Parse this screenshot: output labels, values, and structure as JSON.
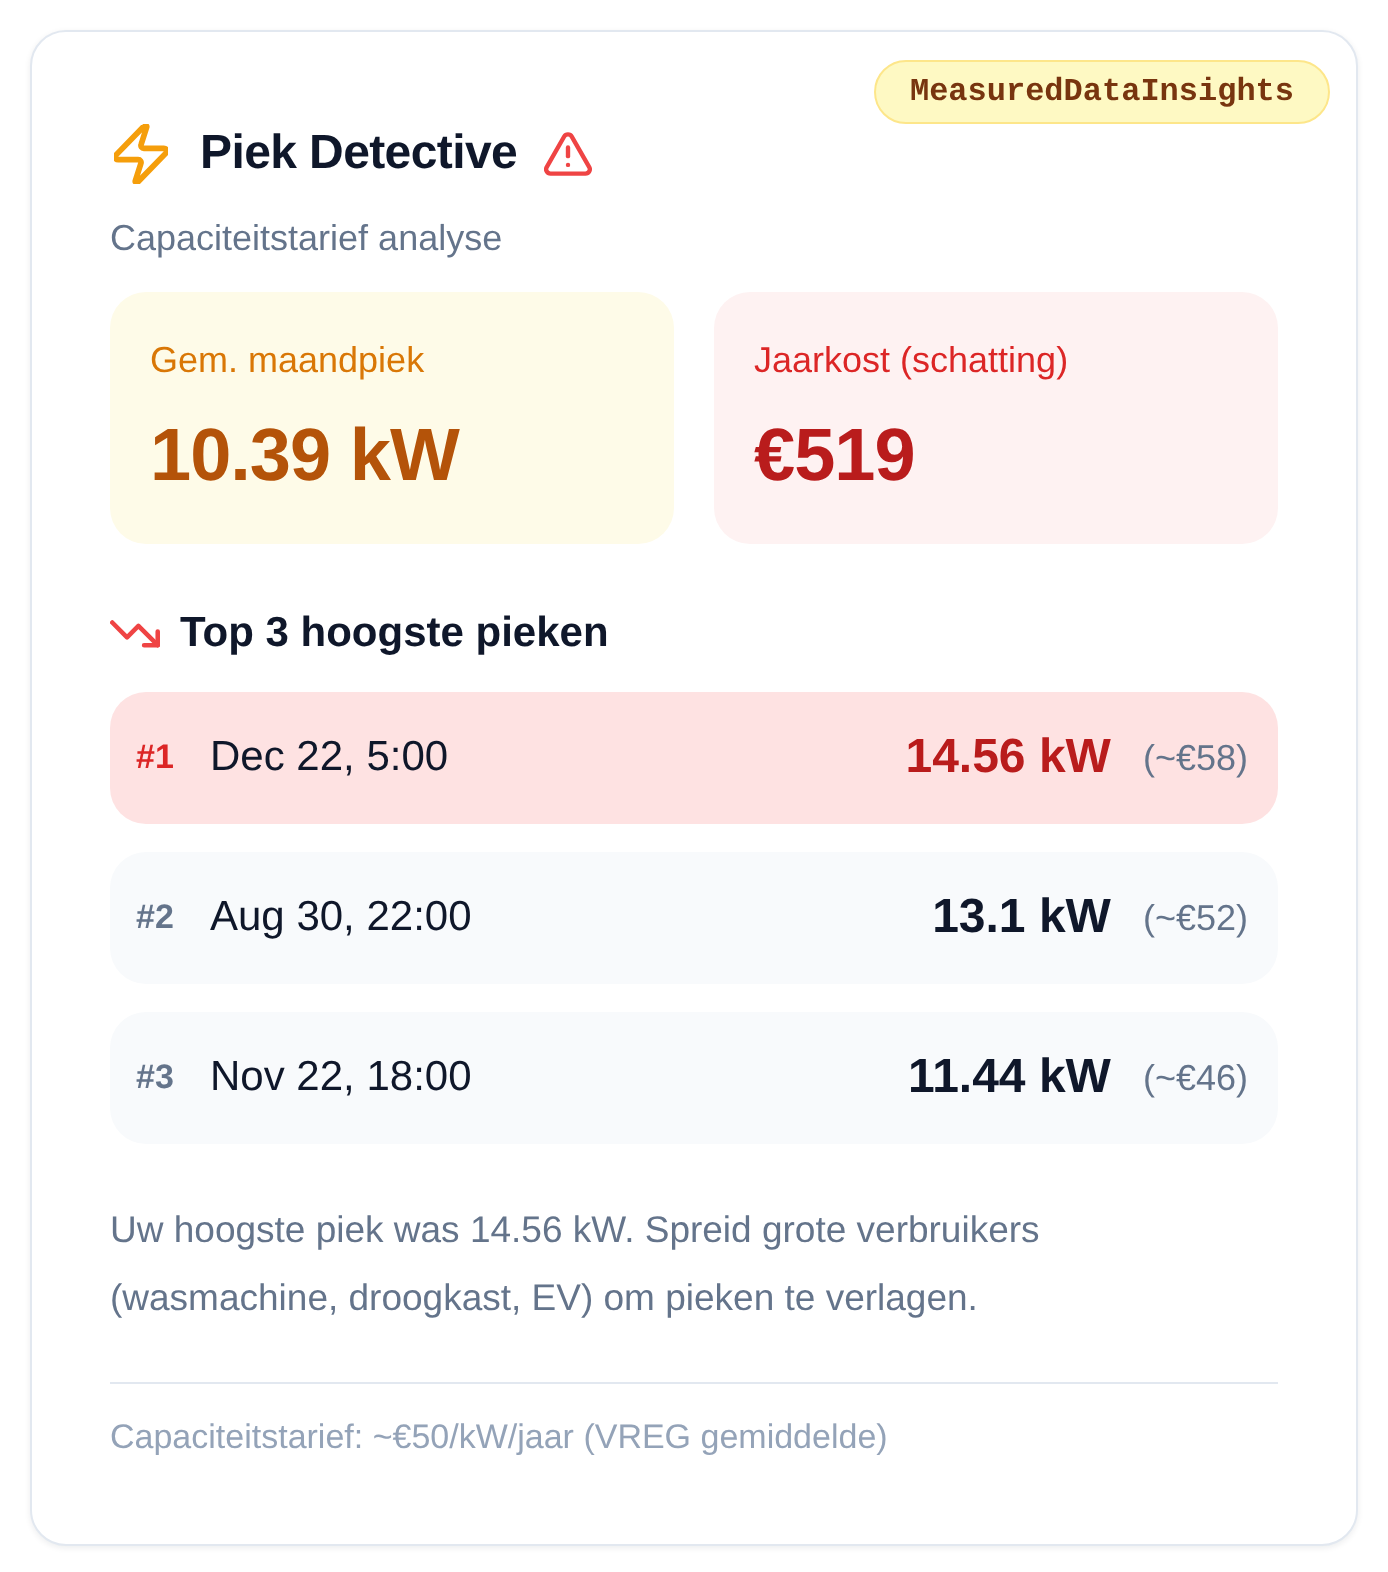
{
  "badge": "MeasuredDataInsights",
  "header": {
    "title": "Piek Detective",
    "subtitle": "Capaciteitstarief analyse"
  },
  "stats": [
    {
      "kind": "average",
      "label": "Gem. maandpiek",
      "value": "10.39 kW"
    },
    {
      "kind": "cost",
      "label": "Jaarkost (schatting)",
      "value": "€519"
    }
  ],
  "peaks_heading": "Top 3 hoogste pieken",
  "peaks": [
    {
      "rank": "#1",
      "date": "Dec 22, 5:00",
      "value": "14.56 kW",
      "cost": "(~€58)",
      "highlighted": true
    },
    {
      "rank": "#2",
      "date": "Aug 30, 22:00",
      "value": "13.1 kW",
      "cost": "(~€52)",
      "highlighted": false
    },
    {
      "rank": "#3",
      "date": "Nov 22, 18:00",
      "value": "11.44 kW",
      "cost": "(~€46)",
      "highlighted": false
    }
  ],
  "note": "Uw hoogste piek was 14.56 kW. Spreid grote verbruikers (wasmachine, droogkast, EV) om pieken te verlagen.",
  "footer": "Capaciteitstarief: ~€50/kW/jaar (VREG gemiddelde)"
}
